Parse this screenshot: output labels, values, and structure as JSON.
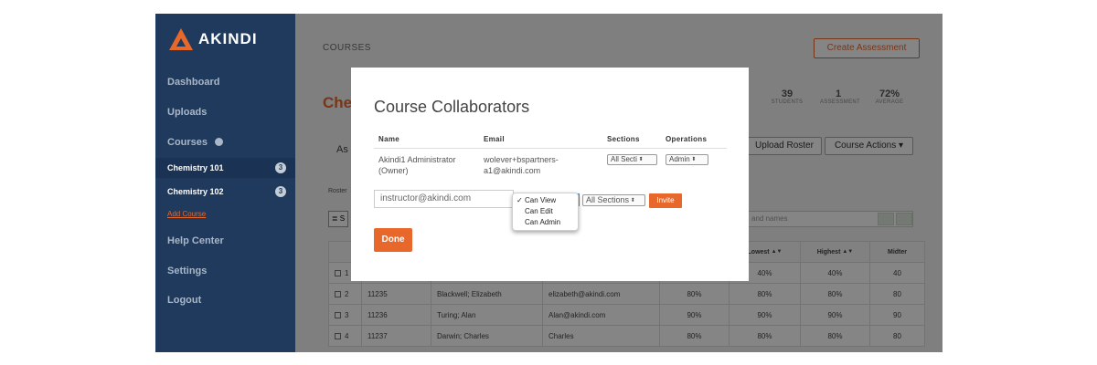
{
  "sidebar": {
    "brand": "AKINDI",
    "items": [
      {
        "label": "Dashboard"
      },
      {
        "label": "Uploads"
      },
      {
        "label": "Courses"
      },
      {
        "label": "Help Center"
      },
      {
        "label": "Settings"
      },
      {
        "label": "Logout"
      }
    ],
    "courses": [
      {
        "label": "Chemistry 101",
        "count": "3"
      },
      {
        "label": "Chemistry 102",
        "count": "3"
      }
    ],
    "add_course": "Add Course"
  },
  "main": {
    "breadcrumb": "COURSES",
    "create_assessment": "Create Assessment",
    "course_title": "Che",
    "stats": [
      {
        "value": "39",
        "label": "STUDENTS"
      },
      {
        "value": "1",
        "label": "ASSESSMENT"
      },
      {
        "value": "72%",
        "label": "AVERAGE"
      }
    ],
    "tab": "As",
    "upload_roster": "Upload Roster",
    "course_actions": "Course Actions",
    "roster_label": "Roster",
    "search_placeholder": "and names",
    "list_button": "≣ S",
    "table": {
      "headers": {
        "lowest": "Lowest",
        "highest": "Highest",
        "midterm": "Midter"
      },
      "rows": [
        {
          "num": "1",
          "id": "",
          "name": "",
          "email": "",
          "avg": "",
          "lowest": "40%",
          "highest": "40%",
          "midterm": "40"
        },
        {
          "num": "2",
          "id": "11235",
          "name": "Blackwell; Elizabeth",
          "email": "elizabeth@akindi.com",
          "avg": "80%",
          "lowest": "80%",
          "highest": "80%",
          "midterm": "80"
        },
        {
          "num": "3",
          "id": "11236",
          "name": "Turing; Alan",
          "email": "Alan@akindi.com",
          "avg": "90%",
          "lowest": "90%",
          "highest": "90%",
          "midterm": "90"
        },
        {
          "num": "4",
          "id": "11237",
          "name": "Darwin; Charles",
          "email": "Charles",
          "avg": "80%",
          "lowest": "80%",
          "highest": "80%",
          "midterm": "80"
        }
      ]
    }
  },
  "modal": {
    "title": "Course Collaborators",
    "headers": {
      "name": "Name",
      "email": "Email",
      "sections": "Sections",
      "operations": "Operations"
    },
    "collaborator": {
      "name_line1": "Akindi1 Administrator",
      "name_line2": "(Owner)",
      "email_line1": "wolever+bspartners-",
      "email_line2": "a1@akindi.com",
      "sections": "All Secti",
      "operations": "Admin"
    },
    "invite": {
      "email_value": "instructor@akindi.com",
      "sections": "All Sections",
      "button": "Invite"
    },
    "permission_options": [
      "Can View",
      "Can Edit",
      "Can Admin"
    ],
    "selected_permission": "Can View",
    "done": "Done"
  },
  "colors": {
    "accent": "#e8672a",
    "sidebar": "#1f3a5c"
  }
}
